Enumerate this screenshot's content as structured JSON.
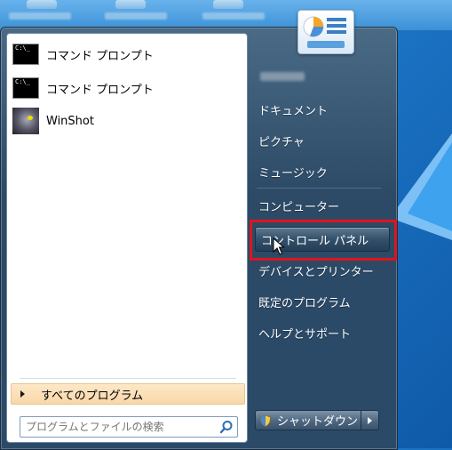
{
  "left_pane": {
    "programs": [
      {
        "label": "コマンド プロンプト",
        "icon": "command-prompt-icon"
      },
      {
        "label": "コマンド プロンプト",
        "icon": "command-prompt-icon"
      },
      {
        "label": "WinShot",
        "icon": "winshot-icon"
      }
    ],
    "cmd_icon_text": "C:\\_",
    "all_programs_label": "すべてのプログラム",
    "search_placeholder": "プログラムとファイルの検索"
  },
  "right_pane": {
    "links": [
      {
        "label": "ドキュメント"
      },
      {
        "label": "ピクチャ"
      },
      {
        "label": "ミュージック"
      },
      {
        "label": "コンピューター"
      },
      {
        "label": "コントロール パネル"
      },
      {
        "label": "デバイスとプリンター"
      },
      {
        "label": "既定のプログラム"
      },
      {
        "label": "ヘルプとサポート"
      }
    ],
    "shutdown_label": "シャットダウン"
  },
  "colors": {
    "highlight_border": "#e0141c",
    "menu_dark": "#2c4a66",
    "all_programs_bg": "#f9d7a8"
  }
}
